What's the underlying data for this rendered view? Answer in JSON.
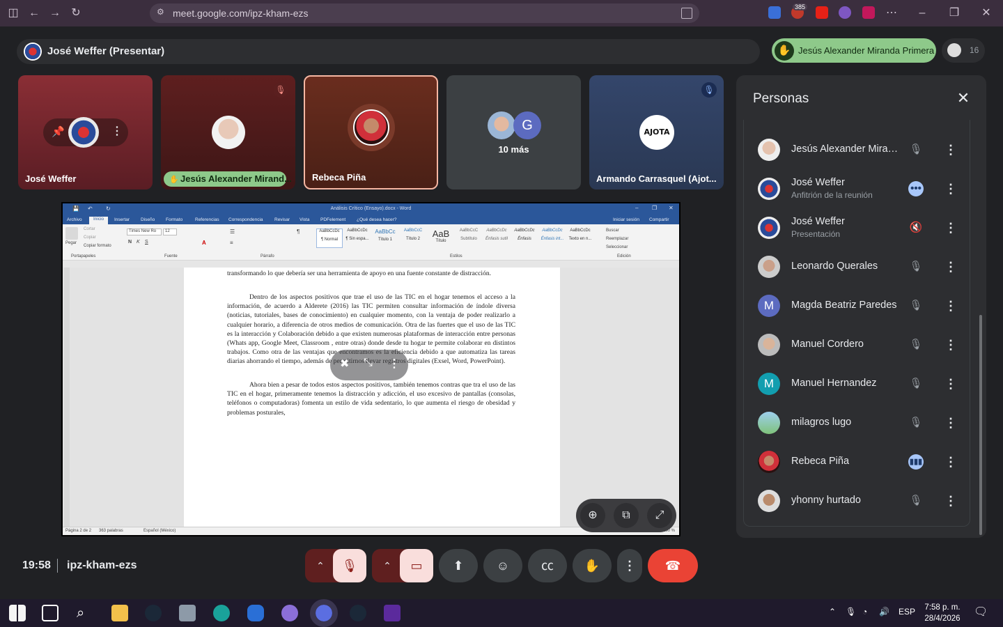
{
  "browser": {
    "url": "meet.google.com/ipz-kham-ezs",
    "extension_badge": "385"
  },
  "meeting": {
    "presenter_label": "José Weffer (Presentar)",
    "hand_raised_name": "Jesús Alexander Miranda Primera",
    "participant_count": "16",
    "time": "19:58",
    "code": "ipz-kham-ezs"
  },
  "tiles": [
    {
      "name": "José Weffer"
    },
    {
      "name": "Jesús Alexander Mirand..."
    },
    {
      "name": "Rebeca Piña"
    },
    {
      "name": "10 más",
      "letter": "G"
    },
    {
      "name": "Armando Carrasquel (Ajot...",
      "logo_text": "AJOTA"
    }
  ],
  "word": {
    "title": "Análisis Crítico (Ensayo).docx - Word",
    "tabs": [
      "Archivo",
      "Inicio",
      "Insertar",
      "Diseño",
      "Formato",
      "Referencias",
      "Correspondencia",
      "Revisar",
      "Vista",
      "PDFelement",
      "¿Qué desea hacer?"
    ],
    "account": "Iniciar sesión",
    "share": "Compartir",
    "font_name": "Times New Ro",
    "font_size": "12",
    "groups": [
      "Portapapeles",
      "Fuente",
      "Párrafo",
      "Estilos",
      "Edición"
    ],
    "clipboard": [
      "Pegar",
      "Cortar",
      "Copiar",
      "Copiar formato"
    ],
    "styles": [
      {
        "preview": "AaBbCcDc",
        "name": "¶ Normal"
      },
      {
        "preview": "AaBbCcDc",
        "name": "¶ Sin espa..."
      },
      {
        "preview": "AaBbCc",
        "name": "Título 1"
      },
      {
        "preview": "AaBbCcC",
        "name": "Título 2"
      },
      {
        "preview": "AaB",
        "name": "Título"
      },
      {
        "preview": "AaBbCcC",
        "name": "Subtítulo"
      },
      {
        "preview": "AaBbCcDc",
        "name": "Énfasis sutil"
      },
      {
        "preview": "AaBbCcDc",
        "name": "Énfasis"
      },
      {
        "preview": "AaBbCcDc",
        "name": "Énfasis int..."
      },
      {
        "preview": "AaBbCcDc",
        "name": "Texto en n..."
      }
    ],
    "editing": [
      "Buscar",
      "Reemplazar",
      "Seleccionar"
    ],
    "paragraph0": "transformando lo que debería ser una herramienta de apoyo en una fuente constante de distracción.",
    "paragraph1": "Dentro de los aspectos positivos que trae el uso de las TIC en el hogar tenemos el acceso a la información, de acuerdo a Alderete (2016) las TIC permiten consultar información de índole diversa (noticias, tutoriales, bases de conocimiento) en cualquier momento, con la ventaja de poder realizarlo a cualquier horario, a diferencia de otros medios de comunicación. Otra de las fuertes que el uso de las TIC es la interacción y Colaboración debido a que existen numerosas plataformas de interacción entre personas (Whats app, Google Meet, Classroom , entre otras) donde desde tu hogar te permite colaborar en distintos trabajos. Como otra de las ventajas que encontramos es la eficiencia debido a que automatiza las tareas diarias ahorrando el tiempo, además de permitirnos llevar registros digitales (Exsel, Word, PowerPoint).",
    "paragraph2": "Ahora bien a pesar de todos estos aspectos positivos, también tenemos contras que tra el uso de las TIC en el hogar, primeramente tenemos la distracción y adicción, el uso excesivo de pantallas (consolas, teléfonos o computadoras) fomenta un estilo de vida sedentario, lo que aumenta el riesgo de obesidad y problemas posturales,",
    "status_page": "Página 2 de 2",
    "status_words": "363 palabras",
    "status_lang": "Español (México)",
    "status_zoom": "100 %"
  },
  "panel": {
    "title": "Personas",
    "participants": [
      {
        "name": "Jesús Alexander Miran...",
        "sub": "",
        "avatar": "photo",
        "mic": "muted"
      },
      {
        "name": "José Weffer",
        "sub": "Anfitrión de la reunión",
        "avatar": "photo",
        "mic": "more"
      },
      {
        "name": "José Weffer",
        "sub": "Presentación",
        "avatar": "photo",
        "mic": "muted-sound"
      },
      {
        "name": "Leonardo Querales",
        "sub": "",
        "avatar": "photo",
        "mic": "muted"
      },
      {
        "name": "Magda Beatriz Paredes",
        "sub": "",
        "avatar": "M",
        "color": "#5c6bc0",
        "mic": "muted"
      },
      {
        "name": "Manuel Cordero",
        "sub": "",
        "avatar": "photo",
        "mic": "muted"
      },
      {
        "name": "Manuel Hernandez",
        "sub": "",
        "avatar": "M",
        "color": "#129eaf",
        "mic": "muted"
      },
      {
        "name": "milagros lugo",
        "sub": "",
        "avatar": "photo",
        "mic": "muted"
      },
      {
        "name": "Rebeca Piña",
        "sub": "",
        "avatar": "photo",
        "mic": "speaking"
      },
      {
        "name": "yhonny hurtado",
        "sub": "",
        "avatar": "photo",
        "mic": "muted"
      }
    ]
  },
  "taskbar": {
    "time": "7:58 p. m.",
    "date": "28/4/2026",
    "lang": "ESP"
  },
  "colors": {
    "end_call": "#ea4335",
    "muted_btn": "#f9dedc",
    "hand_chip": "#8ec98a",
    "word_blue": "#2b579a"
  }
}
